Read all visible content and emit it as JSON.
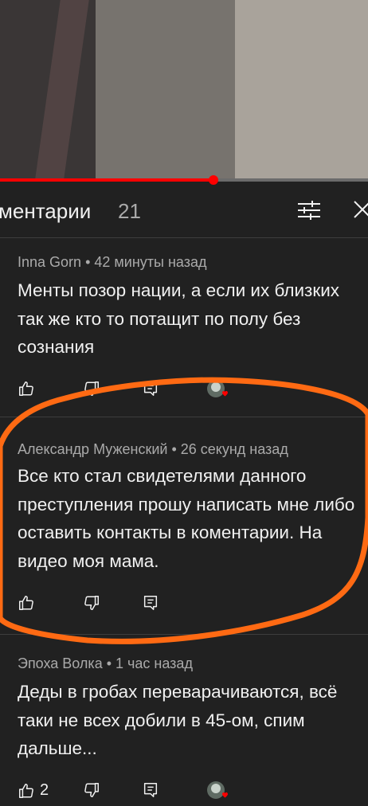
{
  "video": {
    "progress_fraction": 0.58
  },
  "header": {
    "title": "ментарии",
    "count": "21"
  },
  "comments": [
    {
      "author": "Inna Gorn",
      "time": "42 минуты назад",
      "text": "Менты позор нации, а если их близких так же кто то потащит по полу без сознания",
      "likes": "",
      "creator_heart": true
    },
    {
      "author": "Александр Муженский",
      "time": "26 секунд назад",
      "text": "Все кто стал свидетелями данного преступления прошу написать мне либо оставить контакты в коментарии. На видео моя мама.",
      "likes": "",
      "creator_heart": false
    },
    {
      "author": "Эпоха Волка",
      "time": "1 час назад",
      "text": "Деды в гробах переварачиваются, всё таки не всех добили в 45-ом, спим дальше...",
      "likes": "2",
      "creator_heart": true
    }
  ],
  "meta_separator": " • ",
  "colors": {
    "background": "#212121",
    "text": "#f1f1f1",
    "secondary_text": "#aaaaaa",
    "progress": "#ff0000",
    "annotation": "#ff6a13",
    "heart": "#ff0000"
  },
  "icons": {
    "like": "thumbs-up-icon",
    "dislike": "thumbs-down-icon",
    "reply": "reply-icon",
    "filter": "sort-filter-icon",
    "close": "close-icon"
  }
}
